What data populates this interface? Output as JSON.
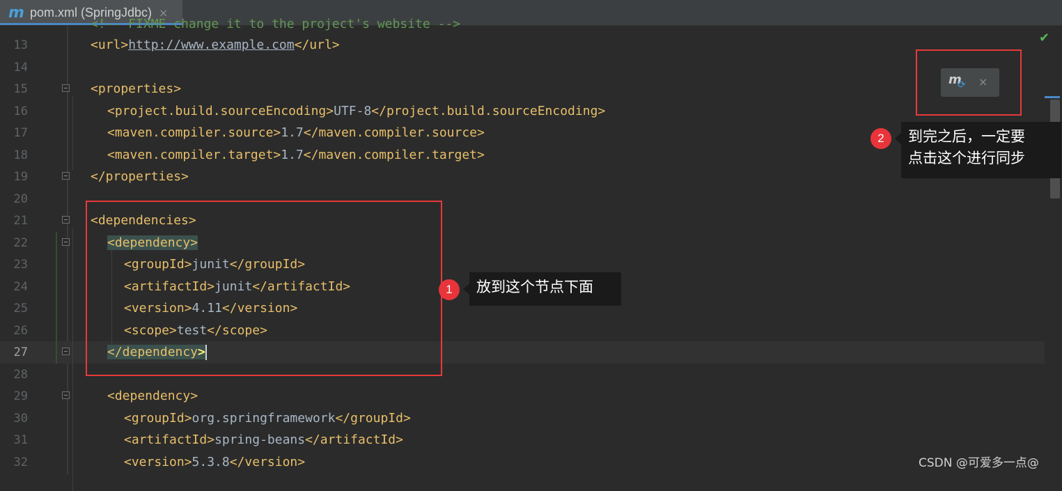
{
  "tab": {
    "icon": "maven-icon",
    "icon_letter": "m",
    "title": "pom.xml (SpringJdbc)",
    "close": "×"
  },
  "editor": {
    "top_partial": "<!-- FIXME change it to the project's website -->",
    "lines": [
      {
        "num": "13",
        "indent": 0,
        "parts": [
          {
            "t": "tag",
            "v": "<url>"
          },
          {
            "t": "url",
            "v": "http://www.example.com"
          },
          {
            "t": "tag",
            "v": "</url>"
          }
        ]
      },
      {
        "num": "14",
        "indent": 0,
        "parts": []
      },
      {
        "num": "15",
        "indent": 0,
        "fold": true,
        "parts": [
          {
            "t": "tag",
            "v": "<properties>"
          }
        ]
      },
      {
        "num": "16",
        "indent": 1,
        "parts": [
          {
            "t": "tag",
            "v": "<project.build.sourceEncoding>"
          },
          {
            "t": "text",
            "v": "UTF-8"
          },
          {
            "t": "tag",
            "v": "</project.build.sourceEncoding>"
          }
        ]
      },
      {
        "num": "17",
        "indent": 1,
        "parts": [
          {
            "t": "tag",
            "v": "<maven.compiler.source>"
          },
          {
            "t": "text",
            "v": "1.7"
          },
          {
            "t": "tag",
            "v": "</maven.compiler.source>"
          }
        ]
      },
      {
        "num": "18",
        "indent": 1,
        "parts": [
          {
            "t": "tag",
            "v": "<maven.compiler.target>"
          },
          {
            "t": "text",
            "v": "1.7"
          },
          {
            "t": "tag",
            "v": "</maven.compiler.target>"
          }
        ]
      },
      {
        "num": "19",
        "indent": 0,
        "fold": true,
        "parts": [
          {
            "t": "tag",
            "v": "</properties>"
          }
        ]
      },
      {
        "num": "20",
        "indent": 0,
        "parts": []
      },
      {
        "num": "21",
        "indent": 0,
        "fold": true,
        "parts": [
          {
            "t": "tag",
            "v": "<dependencies>"
          }
        ]
      },
      {
        "num": "22",
        "indent": 1,
        "fold": true,
        "parts": [
          {
            "t": "open",
            "v": "<dependency>"
          }
        ]
      },
      {
        "num": "23",
        "indent": 2,
        "parts": [
          {
            "t": "tag",
            "v": "<groupId>"
          },
          {
            "t": "text",
            "v": "junit"
          },
          {
            "t": "tag",
            "v": "</groupId>"
          }
        ]
      },
      {
        "num": "24",
        "indent": 2,
        "parts": [
          {
            "t": "tag",
            "v": "<artifactId>"
          },
          {
            "t": "text",
            "v": "junit"
          },
          {
            "t": "tag",
            "v": "</artifactId>"
          }
        ]
      },
      {
        "num": "25",
        "indent": 2,
        "parts": [
          {
            "t": "tag",
            "v": "<version>"
          },
          {
            "t": "text",
            "v": "4.11"
          },
          {
            "t": "tag",
            "v": "</version>"
          }
        ]
      },
      {
        "num": "26",
        "indent": 2,
        "parts": [
          {
            "t": "tag",
            "v": "<scope>"
          },
          {
            "t": "text",
            "v": "test"
          },
          {
            "t": "tag",
            "v": "</scope>"
          }
        ]
      },
      {
        "num": "27",
        "indent": 1,
        "fold": true,
        "current": true,
        "parts": [
          {
            "t": "close",
            "v": "</dependency"
          },
          {
            "t": "bracket",
            "v": ">"
          }
        ]
      },
      {
        "num": "28",
        "indent": 0,
        "parts": []
      },
      {
        "num": "29",
        "indent": 1,
        "fold": true,
        "parts": [
          {
            "t": "tag",
            "v": "<dependency>"
          }
        ]
      },
      {
        "num": "30",
        "indent": 2,
        "parts": [
          {
            "t": "tag",
            "v": "<groupId>"
          },
          {
            "t": "text",
            "v": "org.springframework"
          },
          {
            "t": "tag",
            "v": "</groupId>"
          }
        ]
      },
      {
        "num": "31",
        "indent": 2,
        "parts": [
          {
            "t": "tag",
            "v": "<artifactId>"
          },
          {
            "t": "text",
            "v": "spring-beans"
          },
          {
            "t": "tag",
            "v": "</artifactId>"
          }
        ]
      },
      {
        "num": "32",
        "indent": 2,
        "parts": [
          {
            "t": "tag",
            "v": "<version>"
          },
          {
            "t": "text",
            "v": "5.3.8"
          },
          {
            "t": "tag",
            "v": "</version>"
          }
        ]
      }
    ]
  },
  "inspection": {
    "status_icon": "check-icon",
    "status_glyph": "✔"
  },
  "maven_popup": {
    "icon": "maven-reload-icon",
    "icon_letter": "m",
    "sync_glyph": "⟳",
    "close": "×"
  },
  "annotations": [
    {
      "badge": "1",
      "text": "放到这个节点下面"
    },
    {
      "badge": "2",
      "text_line1": "到完之后，一定要",
      "text_line2": "点击这个进行同步"
    }
  ],
  "watermark": "CSDN @可爱多一点@",
  "colors": {
    "tag": "#e8bf6a",
    "text": "#a9b7c6",
    "annotation_red": "#e83a3a",
    "background": "#2b2b2b"
  }
}
